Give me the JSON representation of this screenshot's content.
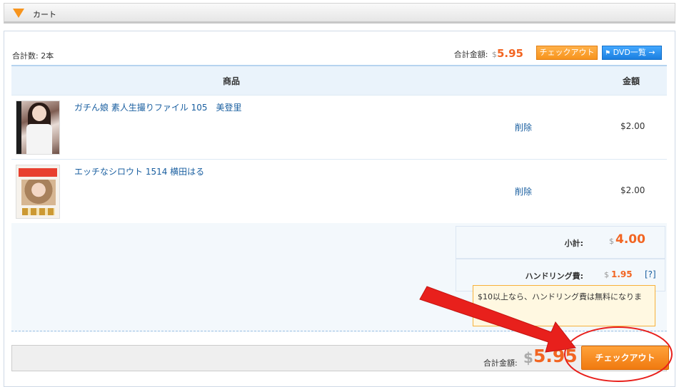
{
  "header": {
    "title": "カート"
  },
  "summary": {
    "item_count": "合計数: 2本",
    "total_label": "合計金額:",
    "currency": "$",
    "total_amount": "5.95"
  },
  "buttons": {
    "checkout_small": "チェックアウト",
    "dvd_list": "DVD一覧 →",
    "checkout_big": "チェックアウト"
  },
  "table": {
    "col_product": "商品",
    "col_amount": "金額",
    "rows": [
      {
        "name": "ガチん娘 素人生撮りファイル 105　美登里",
        "delete": "削除",
        "price": "$2.00"
      },
      {
        "name": "エッチなシロウト 1514 横田はる",
        "delete": "削除",
        "price": "$2.00"
      }
    ]
  },
  "totals": {
    "subtotal_label": "小計:",
    "subtotal_currency": "$",
    "subtotal_value": "4.00",
    "handling_label": "ハンドリング費:",
    "handling_currency": "$",
    "handling_value": "1.95",
    "handling_help": "[?]",
    "notice": "$10以上なら、ハンドリング費は無料になりま"
  },
  "bottom": {
    "total_label": "合計金額:",
    "currency": "$",
    "total_amount": "5.95"
  },
  "colors": {
    "accent_orange": "#f26522",
    "button_orange": "#f7941d",
    "button_blue": "#1b7fe0",
    "link_blue": "#1a5fa0",
    "annotation_red": "#e8201c"
  }
}
